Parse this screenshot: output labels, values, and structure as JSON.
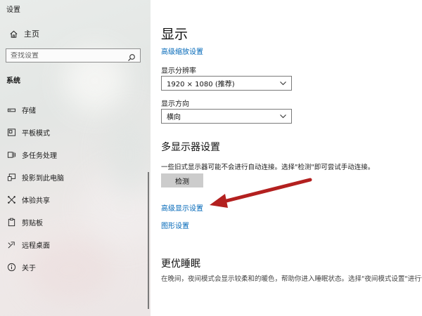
{
  "window": {
    "title": "设置"
  },
  "sidebar": {
    "home_label": "主页",
    "search_placeholder": "查找设置",
    "section_label": "系统",
    "items": [
      {
        "label": "存储",
        "icon": "storage-icon"
      },
      {
        "label": "平板模式",
        "icon": "tablet-mode-icon"
      },
      {
        "label": "多任务处理",
        "icon": "multitasking-icon"
      },
      {
        "label": "投影到此电脑",
        "icon": "projecting-icon"
      },
      {
        "label": "体验共享",
        "icon": "shared-experiences-icon"
      },
      {
        "label": "剪贴板",
        "icon": "clipboard-icon"
      },
      {
        "label": "远程桌面",
        "icon": "remote-desktop-icon"
      },
      {
        "label": "关于",
        "icon": "info-icon"
      }
    ]
  },
  "main": {
    "title": "显示",
    "advanced_scaling_link": "高级缩放设置",
    "resolution_label": "显示分辨率",
    "resolution_value": "1920 × 1080 (推荐)",
    "orientation_label": "显示方向",
    "orientation_value": "横向",
    "multi_display_heading": "多显示器设置",
    "multi_display_desc": "一些旧式显示器可能不会进行自动连接。选择\"检测\"即可尝试手动连接。",
    "detect_button": "检测",
    "advanced_display_link": "高级显示设置",
    "graphics_link": "图形设置",
    "sleep_heading": "更优睡眠",
    "sleep_desc": "在晚间，夜间模式会显示较柔和的暖色，帮助你进入睡眠状态。选择\"夜间模式设置\"进行设"
  },
  "annotation": {
    "arrow_color": "#b3201f"
  },
  "colors": {
    "accent": "#0067b8",
    "button_bg": "#cccccc"
  }
}
